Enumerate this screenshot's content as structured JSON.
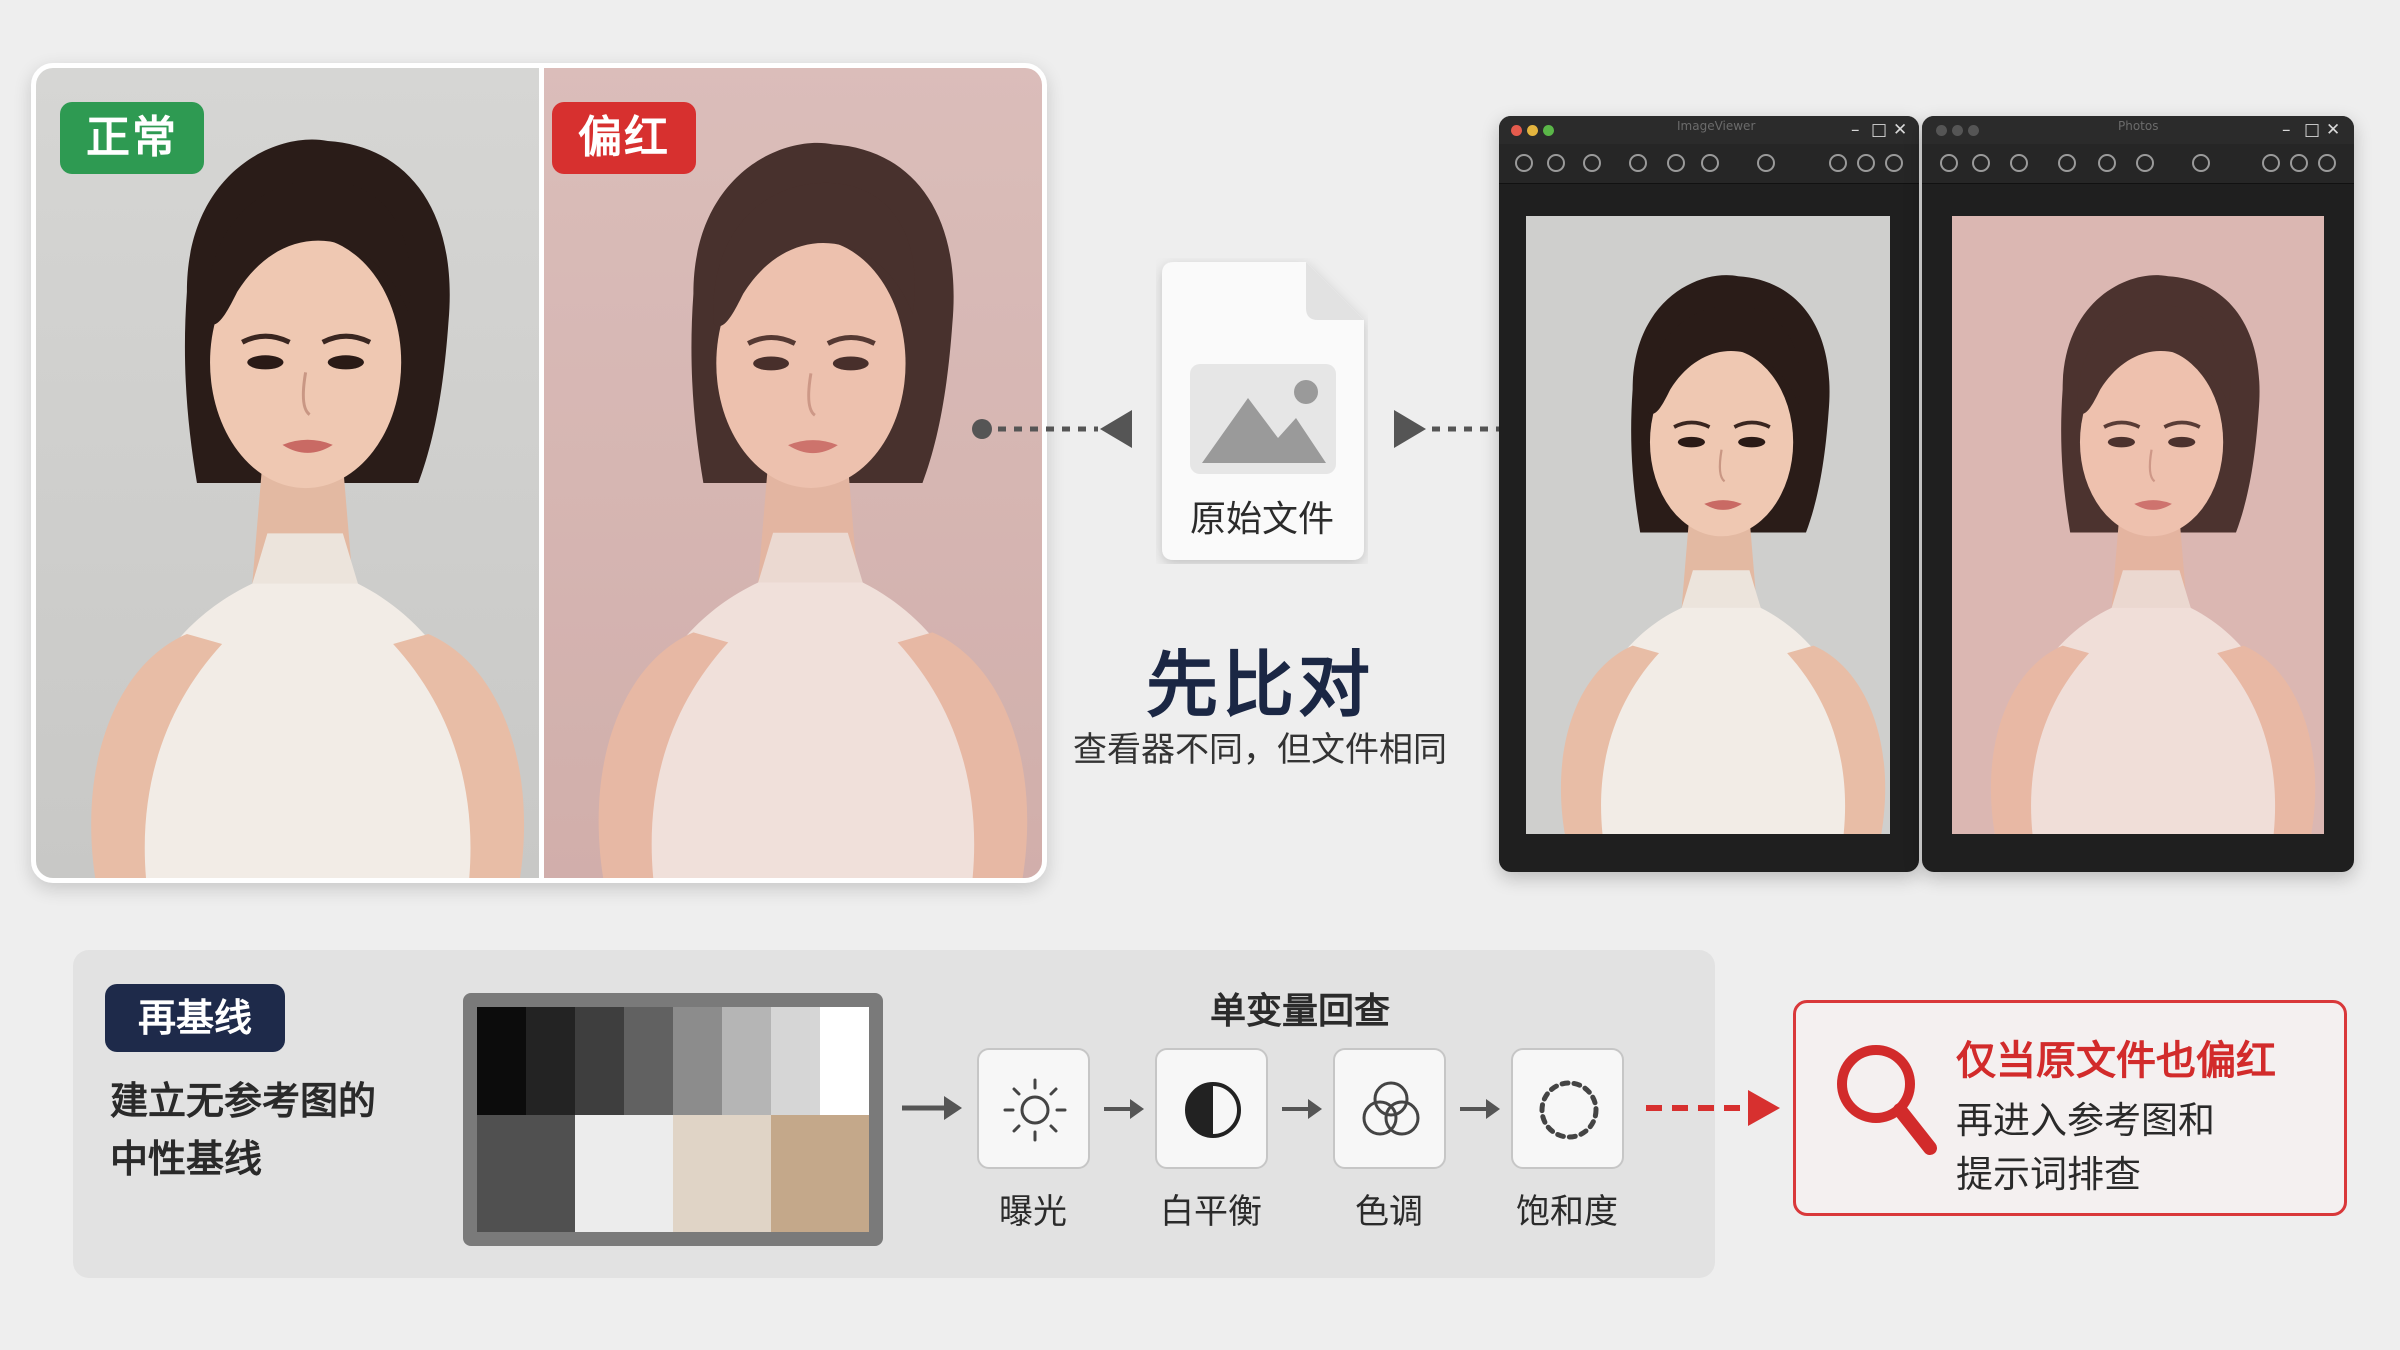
{
  "photos": {
    "normal_tag": "正常",
    "red_tag": "偏红"
  },
  "center": {
    "file_label": "原始文件",
    "title": "先比对",
    "subtitle": "查看器不同，但文件相同"
  },
  "viewers": {
    "left_title": "ImageViewer",
    "right_title": "Photos"
  },
  "baseline": {
    "badge": "再基线",
    "desc_line1": "建立无参考图的",
    "desc_line2": "中性基线"
  },
  "flow": {
    "title": "单变量回查",
    "steps": [
      {
        "label": "曝光",
        "icon": "sun-icon"
      },
      {
        "label": "白平衡",
        "icon": "half-circle-icon"
      },
      {
        "label": "色调",
        "icon": "overlap-circles-icon"
      },
      {
        "label": "饱和度",
        "icon": "dotted-circle-icon"
      }
    ]
  },
  "callout": {
    "title": "仅当原文件也偏红",
    "body_line1": "再进入参考图和",
    "body_line2": "提示词排查",
    "icon": "magnifier-icon"
  },
  "colors": {
    "green_tag": "#2e9a52",
    "red_tag": "#d7302f",
    "navy": "#1e2a4a",
    "alert_red": "#d22b2b"
  }
}
